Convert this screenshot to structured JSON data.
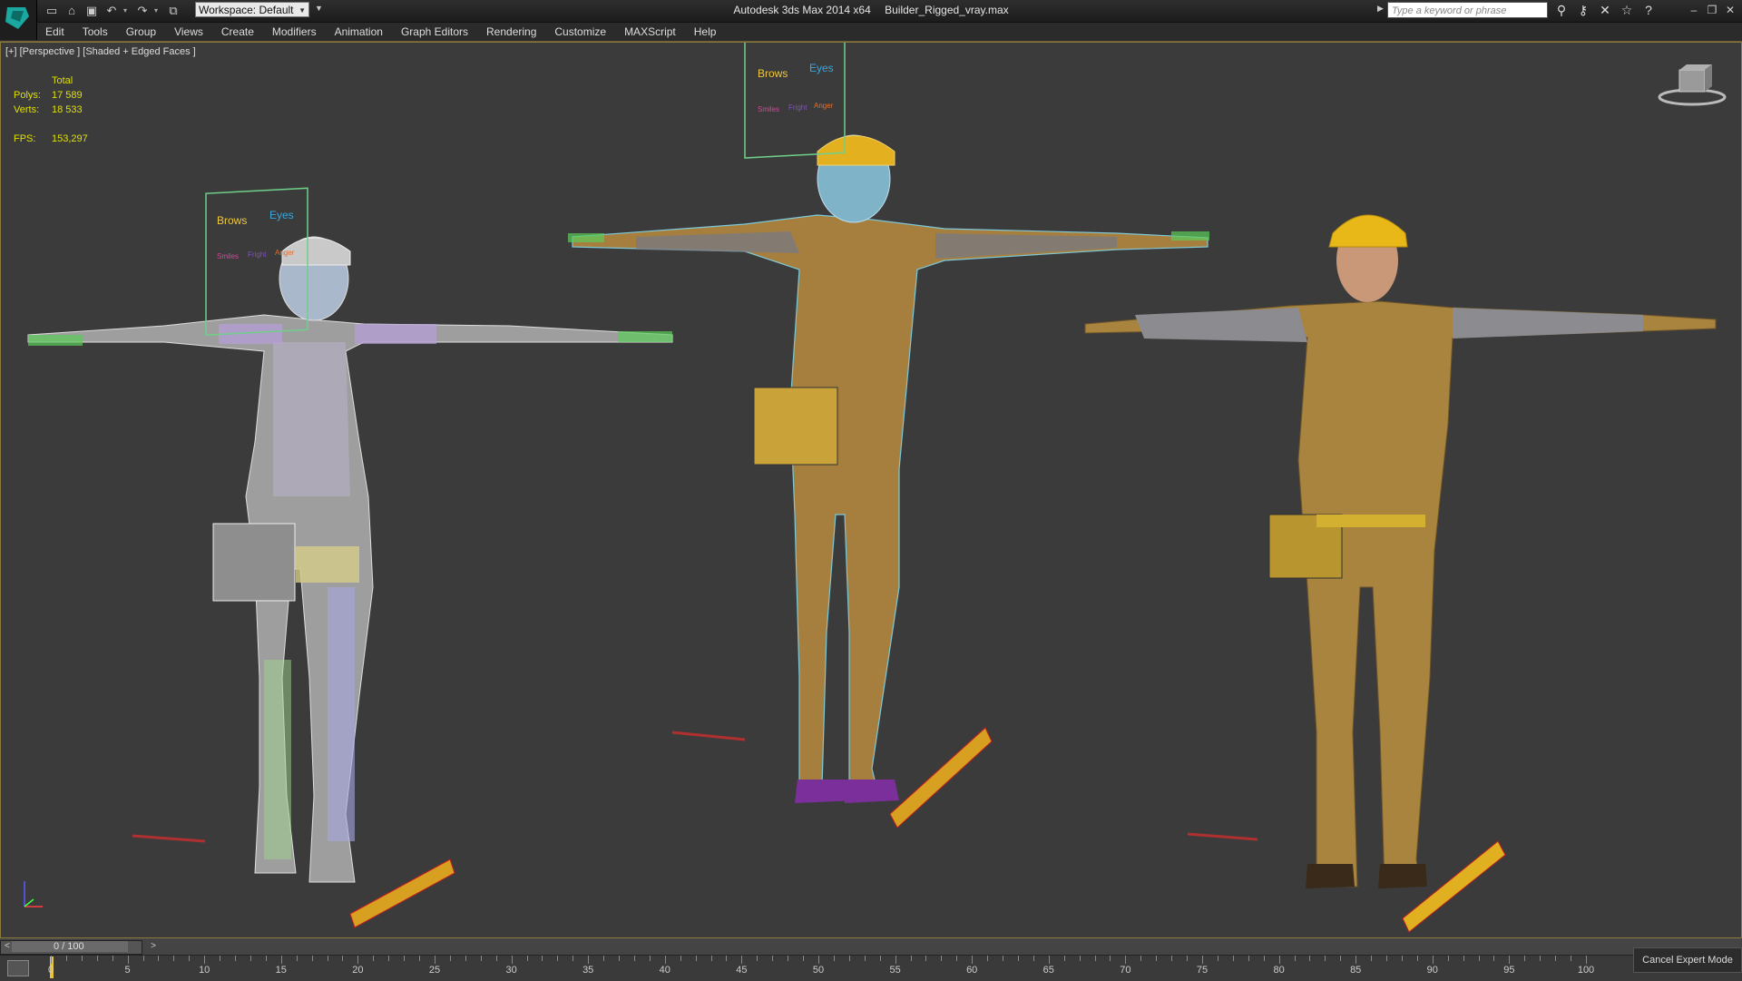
{
  "titlebar": {
    "app_name": "Autodesk 3ds Max  2014 x64",
    "file_name": "Builder_Rigged_vray.max",
    "workspace": "Workspace: Default",
    "search_placeholder": "Type a keyword or phrase"
  },
  "menus": [
    "Edit",
    "Tools",
    "Group",
    "Views",
    "Create",
    "Modifiers",
    "Animation",
    "Graph Editors",
    "Rendering",
    "Customize",
    "MAXScript",
    "Help"
  ],
  "viewport": {
    "label": "[+] [Perspective ] [Shaded + Edged Faces ]",
    "stats": {
      "header": "Total",
      "polys_label": "Polys:",
      "polys": "17 589",
      "verts_label": "Verts:",
      "verts": "18 533",
      "fps_label": "FPS:",
      "fps": "153,297"
    },
    "face_rig_labels": {
      "brows": "Brows",
      "eyes": "Eyes",
      "smiles": "Smiles",
      "fright": "Fright",
      "anger": "Anger"
    }
  },
  "timeline": {
    "position": "0 / 100",
    "ticks": [
      "5",
      "10",
      "15",
      "20",
      "25",
      "30",
      "35",
      "40",
      "45",
      "50",
      "55",
      "60",
      "65",
      "70",
      "75",
      "80",
      "85",
      "90",
      "95",
      "100"
    ],
    "cancel_expert": "Cancel Expert Mode",
    "start": "0"
  },
  "colors": {
    "viewport_bg": "#3b3b3b",
    "accent_border": "#8a7a3e",
    "stats_text": "#e0e000",
    "playhead": "#e8c23a"
  }
}
